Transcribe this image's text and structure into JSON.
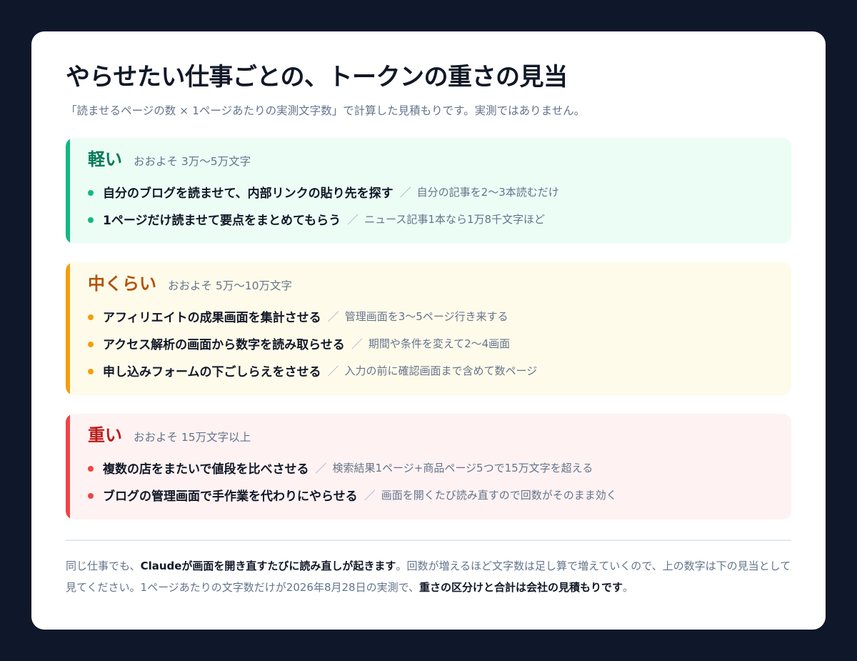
{
  "header": {
    "title": "やらせたい仕事ごとの、トークンの重さの見当",
    "subtitle": "「読ませるページの数 × 1ページあたりの実測文字数」で計算した見積もりです。実測ではありません。"
  },
  "tiers": [
    {
      "name": "軽い",
      "range": "おおよそ 3万〜5万文字",
      "accent": "#10b981",
      "items": [
        {
          "main": "自分のブログを読ませて、内部リンクの貼り先を探す",
          "sep": "／",
          "note": "自分の記事を2〜3本読むだけ"
        },
        {
          "main": "1ページだけ読ませて要点をまとめてもらう",
          "sep": "／",
          "note": "ニュース記事1本なら1万8千文字ほど"
        }
      ]
    },
    {
      "name": "中くらい",
      "range": "おおよそ 5万〜10万文字",
      "accent": "#f59e0b",
      "items": [
        {
          "main": "アフィリエイトの成果画面を集計させる",
          "sep": "／",
          "note": "管理画面を3〜5ページ行き来する"
        },
        {
          "main": "アクセス解析の画面から数字を読み取らせる",
          "sep": "／",
          "note": "期間や条件を変えて2〜4画面"
        },
        {
          "main": "申し込みフォームの下ごしらえをさせる",
          "sep": "／",
          "note": "入力の前に確認画面まで含めて数ページ"
        }
      ]
    },
    {
      "name": "重い",
      "range": "おおよそ 15万文字以上",
      "accent": "#ef4444",
      "items": [
        {
          "main": "複数の店をまたいで値段を比べさせる",
          "sep": "／",
          "note": "検索結果1ページ+商品ページ5つで15万文字を超える"
        },
        {
          "main": "ブログの管理画面で手作業を代わりにやらせる",
          "sep": "／",
          "note": "画面を開くたび読み直すので回数がそのまま効く"
        }
      ]
    }
  ],
  "footer": {
    "part1": "同じ仕事でも、",
    "bold1": "Claudeが画面を開き直すたびに読み直しが起きます",
    "part2": "。回数が増えるほど文字数は足し算で増えていくので、上の数字は下の見当として見てください。1ページあたりの文字数だけが2026年8月28日の実測で、",
    "bold2": "重さの区分けと合計は会社の見積もりです",
    "part3": "。"
  }
}
